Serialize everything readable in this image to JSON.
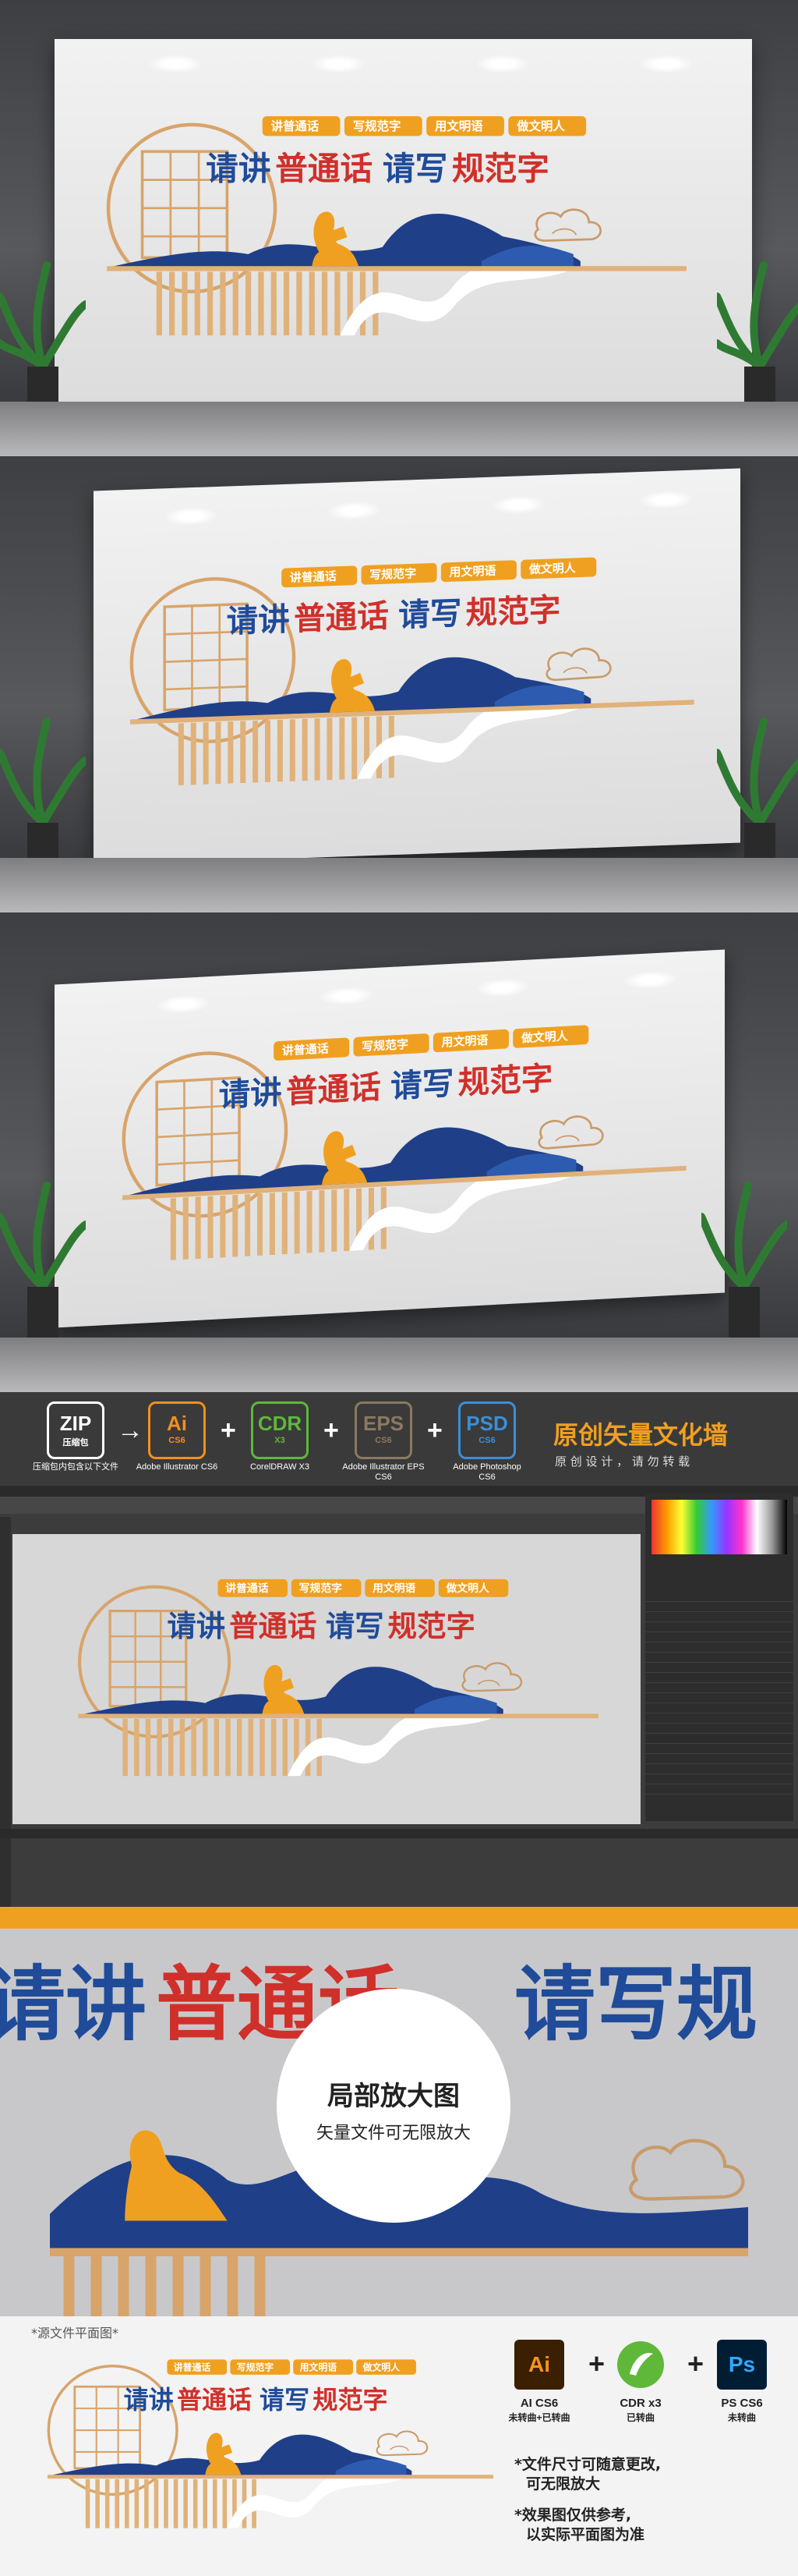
{
  "design": {
    "tags": [
      "讲普通话",
      "写规范字",
      "用文明语",
      "做文明人"
    ],
    "slogan_part1": "请讲",
    "slogan_part2": "普通话",
    "slogan_part3": "请写",
    "slogan_part4": "规范字"
  },
  "formats": {
    "zip_title": "ZIP",
    "zip_sub": "压缩包",
    "zip_caption": "压缩包内包含以下文件",
    "items": [
      {
        "icon": "Ai",
        "version": "CS6",
        "caption": "Adobe Illustrator CS6",
        "color": "#f09020"
      },
      {
        "icon": "CDR",
        "version": "X3",
        "caption": "CorelDRAW X3",
        "color": "#5fb83a"
      },
      {
        "icon": "EPS",
        "version": "CS6",
        "caption": "Adobe Illustrator EPS CS6",
        "color": "#8a7a60"
      },
      {
        "icon": "PSD",
        "version": "CS6",
        "caption": "Adobe Photoshop CS6",
        "color": "#3a8fd8"
      }
    ],
    "brand_title": "原创矢量文化墙",
    "brand_sub": "原 创 设 计 ， 请 勿 转 载"
  },
  "zoom": {
    "title": "局部放大图",
    "subtitle": "矢量文件可无限放大",
    "bg_text1": "请讲",
    "bg_text2": "普通话",
    "bg_text3": "请写规"
  },
  "bottom": {
    "label": "*源文件平面图*",
    "sw_ai": "Ai",
    "sw_ai_cap1": "AI CS6",
    "sw_ai_cap2": "未转曲+已转曲",
    "sw_cdr_cap1": "CDR x3",
    "sw_cdr_cap2": "已转曲",
    "sw_ps": "Ps",
    "sw_ps_cap1": "PS CS6",
    "sw_ps_cap2": "未转曲",
    "note1a": "*文件尺寸可随意更改,",
    "note1b": "可无限放大",
    "note2a": "*效果图仅供参考,",
    "note2b": "以实际平面图为准"
  }
}
